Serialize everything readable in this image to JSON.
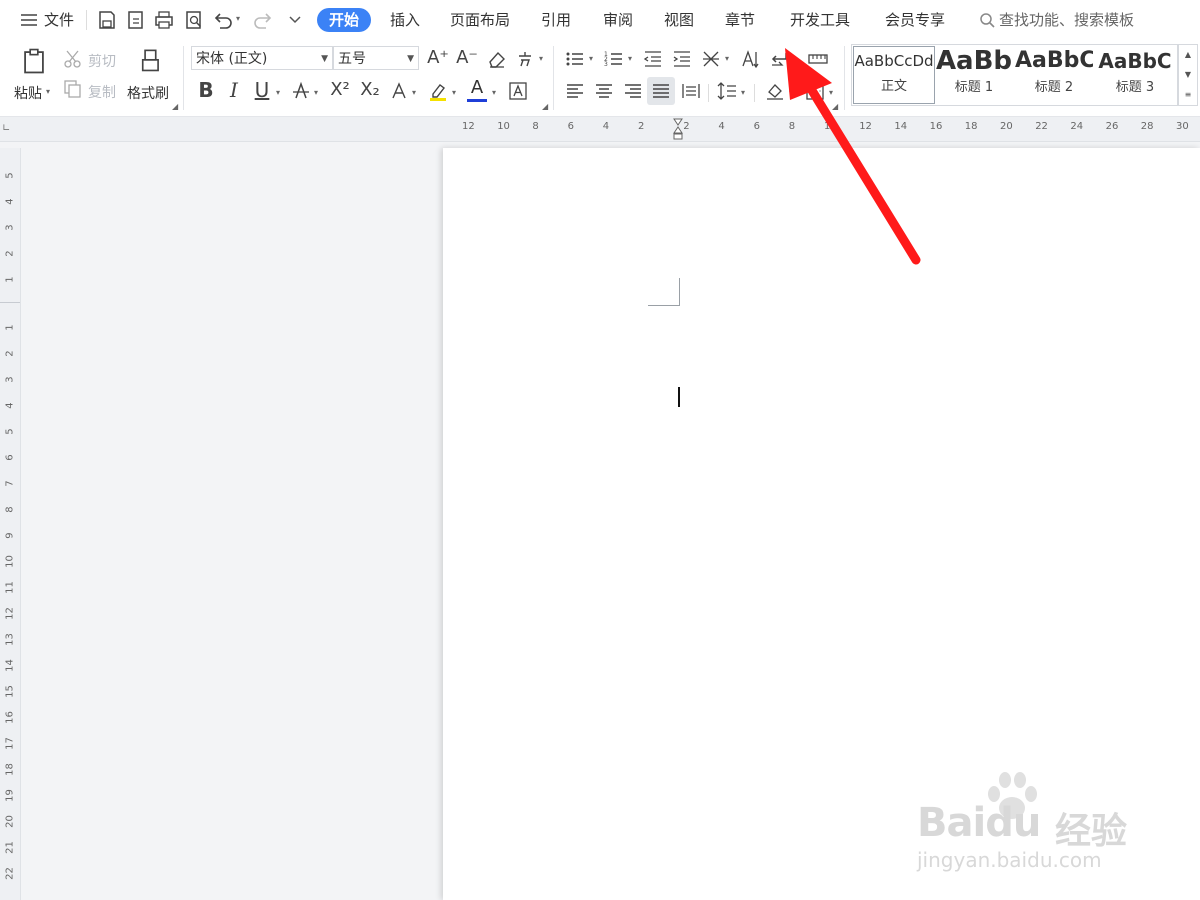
{
  "menubar": {
    "file_label": "文件",
    "tabs": [
      "开始",
      "插入",
      "页面布局",
      "引用",
      "审阅",
      "视图",
      "章节",
      "开发工具",
      "会员专享"
    ],
    "search_placeholder": "查找功能、搜索模板"
  },
  "clipboard": {
    "paste_label": "粘贴",
    "cut_label": "剪切",
    "copy_label": "复制",
    "format_painter_label": "格式刷"
  },
  "font": {
    "family": "宋体 (正文)",
    "size": "五号",
    "bold_glyph": "B",
    "italic_glyph": "I",
    "underline_glyph": "U",
    "grow_glyph": "A⁺",
    "shrink_glyph": "A⁻",
    "superscript_glyph": "X²",
    "subscript_glyph": "X₂",
    "color_glyph": "A",
    "colors": {
      "highlight": "#f5e100",
      "font_color": "#1f3fd8"
    }
  },
  "styles": [
    {
      "sample": "AaBbCcDd",
      "name": "正文"
    },
    {
      "sample": "AaBb",
      "name": "标题 1"
    },
    {
      "sample": "AaBbC",
      "name": "标题 2"
    },
    {
      "sample": "AaBbC",
      "name": "标题 3"
    }
  ],
  "ruler": {
    "horizontal": [
      "12",
      "10",
      "8",
      "6",
      "4",
      "2",
      "2",
      "4",
      "6",
      "8",
      "10",
      "12",
      "14",
      "16",
      "18",
      "20",
      "22",
      "24",
      "26",
      "28",
      "30"
    ],
    "vertical": [
      "5",
      "4",
      "3",
      "2",
      "1",
      "1",
      "2",
      "3",
      "4",
      "5",
      "6",
      "7",
      "8",
      "9",
      "10",
      "11",
      "12",
      "13",
      "14",
      "15",
      "16",
      "17",
      "18",
      "19",
      "20",
      "21",
      "22"
    ]
  },
  "watermark": {
    "brand": "Baidu",
    "cn": "经验",
    "url": "jingyan.baidu.com"
  },
  "colors": {
    "accent": "#3b82f6",
    "arrow": "#ff1a1a"
  }
}
